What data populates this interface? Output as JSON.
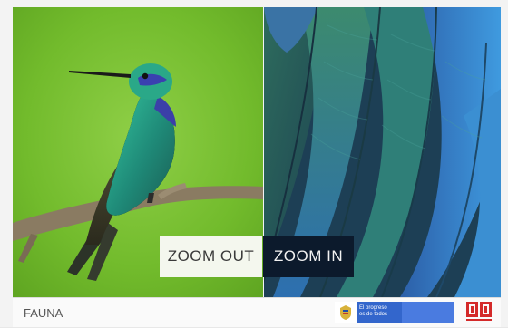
{
  "viewer": {
    "zoom_out_label": "ZOOM OUT",
    "zoom_in_label": "ZOOM IN"
  },
  "footer": {
    "section_label": "FAUNA",
    "gov_banner_line1": "El progreso",
    "gov_banner_line2": "es de todos"
  },
  "icons": {
    "gov_seal": "colombia-seal-icon",
    "brand_logo": "red-brand-logo-icon"
  },
  "colors": {
    "zoom_in_bg": "#0c1a2c",
    "zoom_out_bg": "#f4f7ee",
    "gov_blue": "#3366cc",
    "brand_red": "#d42a2a"
  }
}
